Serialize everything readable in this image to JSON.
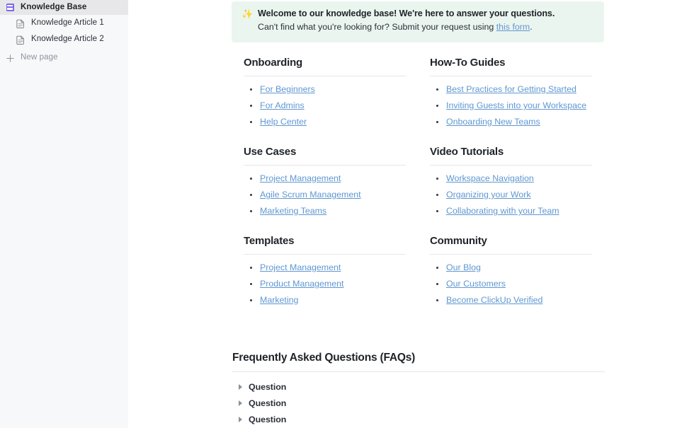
{
  "sidebar": {
    "root": {
      "label": "Knowledge Base",
      "icon": "book-icon"
    },
    "items": [
      {
        "label": "Knowledge Article 1",
        "icon": "document-icon"
      },
      {
        "label": "Knowledge Article 2",
        "icon": "document-icon"
      }
    ],
    "new_page": {
      "label": "New page",
      "icon": "plus-icon"
    }
  },
  "banner": {
    "icon": "sparkles-icon",
    "icon_glyph": "✨",
    "title": "Welcome to our knowledge base! We're here to answer your questions.",
    "subtitle_before": "Can't find what you're looking for? Submit your request using ",
    "link_text": "this form",
    "subtitle_after": ".",
    "background_color": "#ebf5ef"
  },
  "colors": {
    "link": "#5f97d1",
    "heading": "#1f2328",
    "accent_purple": "#7b68ee",
    "sparkle_yellow": "#f5c84c",
    "rule": "#e6e7ea"
  },
  "sections": [
    {
      "title": "Onboarding",
      "links": [
        "For Beginners",
        "For Admins",
        "Help Center"
      ]
    },
    {
      "title": "How-To Guides",
      "links": [
        "Best Practices for Getting Started",
        "Inviting Guests into your Workspace",
        "Onboarding New Teams"
      ]
    },
    {
      "title": "Use Cases",
      "links": [
        "Project Management",
        "Agile Scrum Management",
        "Marketing Teams"
      ]
    },
    {
      "title": "Video Tutorials",
      "links": [
        "Workspace Navigation",
        "Organizing your Work",
        "Collaborating with your Team"
      ]
    },
    {
      "title": "Templates",
      "links": [
        "Project Management",
        "Product Management",
        "Marketing"
      ]
    },
    {
      "title": "Community",
      "links": [
        "Our Blog",
        "Our Customers",
        "Become ClickUp Verified"
      ]
    }
  ],
  "faq": {
    "title": "Frequently Asked Questions (FAQs)",
    "items": [
      "Question",
      "Question",
      "Question"
    ]
  }
}
